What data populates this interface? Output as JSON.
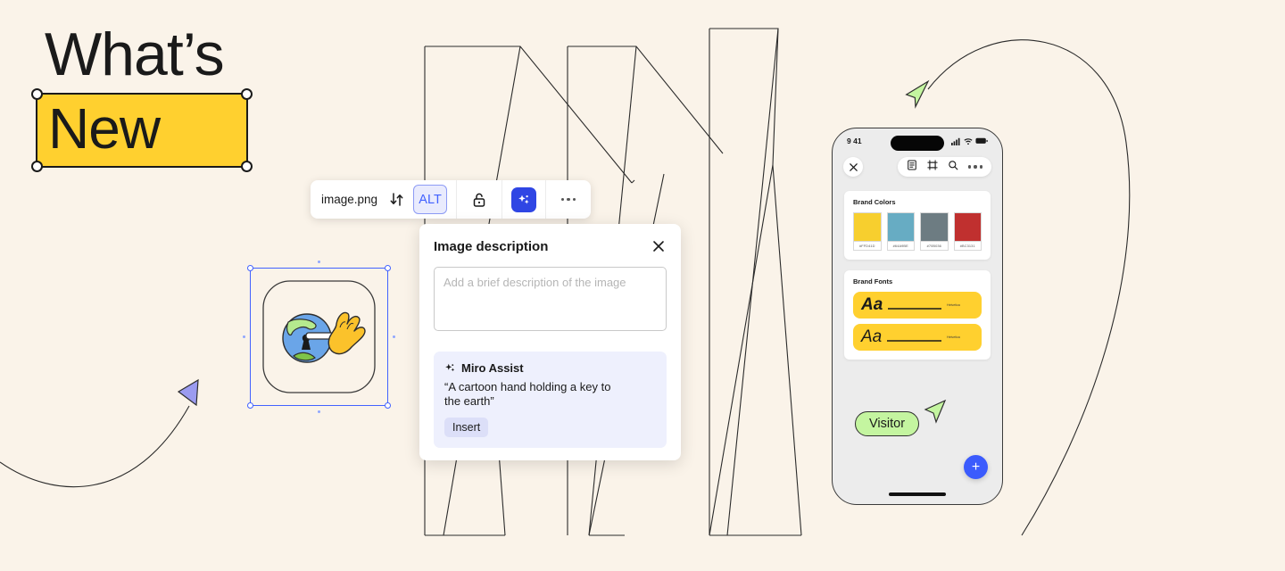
{
  "page": {
    "background_color": "#faf3e9",
    "accent_blue": "#4262ff",
    "brand_yellow": "#ffd02f"
  },
  "headline": {
    "line1": "What’s",
    "line2": "New",
    "highlight_color": "#ffd02f"
  },
  "image_toolbar": {
    "filename": "image.png",
    "swap_icon": "swap-arrows-icon",
    "alt_label": "ALT",
    "lock_icon": "unlock-icon",
    "ai_icon": "sparkle-icon",
    "more_icon": "more-horizontal-icon"
  },
  "dialog": {
    "title": "Image description",
    "close_icon": "close-icon",
    "textarea_value": "",
    "textarea_placeholder": "Add a brief description of the image",
    "assist": {
      "icon": "sparkle-icon",
      "title": "Miro Assist",
      "suggestion": "“A cartoon hand holding a key to the earth”",
      "insert_label": "Insert"
    }
  },
  "canvas_image": {
    "alt": "cartoon earth with keyhole and yellow hand holding a key",
    "selected": true
  },
  "cursors": {
    "purple": {
      "color": "#9b9bf0",
      "label": ""
    },
    "green": {
      "color": "#c4f5a0",
      "label": ""
    },
    "visitor": {
      "label": "Visitor",
      "color": "#c4f5a0"
    }
  },
  "phone": {
    "status": {
      "time": "9 41",
      "signal_icon": "cellular-signal-icon",
      "wifi_icon": "wifi-icon",
      "battery_icon": "battery-icon"
    },
    "topbar": {
      "close_icon": "close-icon",
      "notes_icon": "document-icon",
      "frame_icon": "frame-icon",
      "search_icon": "search-icon",
      "more_icon": "more-horizontal-icon"
    },
    "brand_colors": {
      "title": "Brand Colors",
      "swatches": [
        {
          "hex_label": "#FFD41D",
          "color": "#f7cf2e"
        },
        {
          "hex_label": "#64A9BE",
          "color": "#67acc3"
        },
        {
          "hex_label": "#70B036",
          "color": "#6d7c82"
        },
        {
          "hex_label": "#BC3131",
          "color": "#c0302f"
        }
      ]
    },
    "brand_fonts": {
      "title": "Brand Fonts",
      "items": [
        {
          "sample": "Aa",
          "name": "Helvetica",
          "style": "Bold Oblique"
        },
        {
          "sample": "Aa",
          "name": "Helvetica",
          "style": "Light Oblique"
        }
      ]
    },
    "fab_label": "+",
    "fab_icon": "plus-icon"
  }
}
